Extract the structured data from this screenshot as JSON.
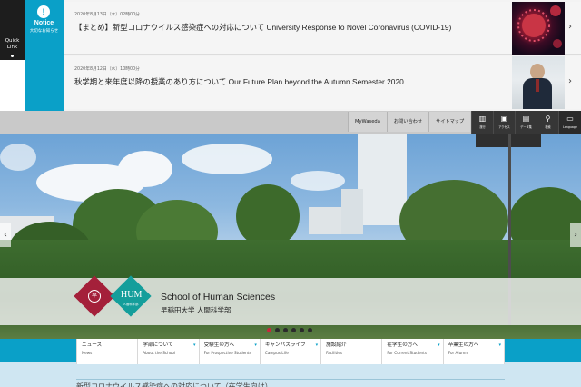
{
  "quick_link": {
    "label": "Quick Link"
  },
  "notice": {
    "title": "Notice",
    "subtitle": "大切なお知らせ",
    "icon": "exclamation-icon"
  },
  "news": [
    {
      "date": "2020年8月13日（木）02時00分",
      "title": "【まとめ】新型コロナウイルス感染症への対応について University Response to Novel Coronavirus (COVID-19)",
      "thumb": "virus-image"
    },
    {
      "date": "2020年8月12日（水）10時00分",
      "title": "秋学期と来年度以降の授業のあり方について Our Future Plan beyond the Autumn Semester 2020",
      "thumb": "president-photo"
    }
  ],
  "utility": {
    "links": [
      "MyWaseda",
      "お問い合わせ",
      "サイトマップ"
    ],
    "icons": [
      {
        "label": "旅行",
        "icon": "building-icon"
      },
      {
        "label": "アクセス",
        "icon": "bus-icon"
      },
      {
        "label": "データ集",
        "icon": "chart-icon"
      },
      {
        "label": "検索",
        "icon": "search-icon"
      },
      {
        "label": "Language",
        "icon": "chat-icon"
      }
    ]
  },
  "hero": {
    "school_en": "School of Human Sciences",
    "school_jp": "早稲田大学 人間科学部",
    "logo_text": "HUM",
    "logo_sub": "人間科学部",
    "seal_text": "早",
    "slide_count": 6,
    "active_slide": 1
  },
  "nav": [
    {
      "jp": "ニュース",
      "en": "News"
    },
    {
      "jp": "学部について",
      "en": "About the School"
    },
    {
      "jp": "受験生の方へ",
      "en": "For Prospective Students"
    },
    {
      "jp": "キャンパスライフ",
      "en": "Campus Life"
    },
    {
      "jp": "施設紹介",
      "en": "Facilities"
    },
    {
      "jp": "在学生の方へ",
      "en": "For Current Students"
    },
    {
      "jp": "卒業生の方へ",
      "en": "For Alumni"
    }
  ],
  "headline_peek": "新型コロナウイルス感染症への対応について（在学生向け）",
  "colors": {
    "teal": "#0aa0c8",
    "crimson": "#a4203a",
    "hum_teal": "#149e9b"
  }
}
